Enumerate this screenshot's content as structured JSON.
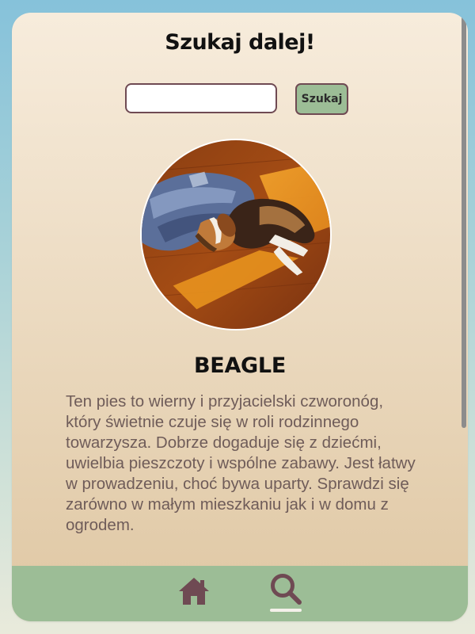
{
  "header": {
    "title": "Szukaj dalej!"
  },
  "search": {
    "input_value": "",
    "placeholder": "",
    "button_label": "Szukaj"
  },
  "breed": {
    "name": "BEAGLE",
    "description": "Ten pies to wierny i przyjacielski czworonóg, który świetnie czuje się w roli rodzinnego towarzysza. Dobrze dogaduje się z dziećmi, uwielbia pieszczoty i wspólne zabawy. Jest łatwy w prowadzeniu, choć bywa uparty. Sprawdzi się zarówno w małym mieszkaniu jak i w domu z ogrodem."
  },
  "nav": {
    "items": [
      {
        "icon": "home-icon",
        "active": false
      },
      {
        "icon": "search-icon",
        "active": true
      }
    ]
  },
  "colors": {
    "nav_background": "#9cbd96",
    "button_background": "#9cbd96",
    "border_accent": "#6f4a53",
    "description_text": "#6f5c59",
    "icon_color": "#6f4a53"
  }
}
